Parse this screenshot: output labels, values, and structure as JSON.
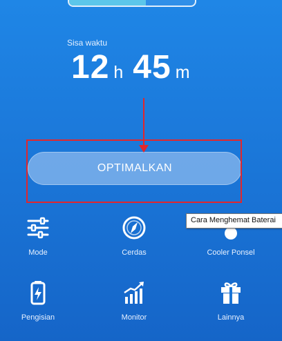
{
  "battery": {
    "level": 0.61
  },
  "remaining": {
    "label": "Sisa waktu",
    "hours": "12",
    "hours_unit": "h",
    "minutes": "45",
    "minutes_unit": "m"
  },
  "optimize_button": "OPTIMALKAN",
  "tooltip": "Cara Menghemat Baterai",
  "grid": [
    {
      "label": "Mode",
      "icon": "sliders-icon"
    },
    {
      "label": "Cerdas",
      "icon": "compass-icon"
    },
    {
      "label": "Cooler Ponsel",
      "icon": "fan-icon"
    },
    {
      "label": "Pengisian",
      "icon": "battery-charging-icon"
    },
    {
      "label": "Monitor",
      "icon": "chart-up-icon"
    },
    {
      "label": "Lainnya",
      "icon": "gift-icon"
    }
  ],
  "colors": {
    "annotation": "#e3262b",
    "battery_fill": "#5cc6ea"
  }
}
